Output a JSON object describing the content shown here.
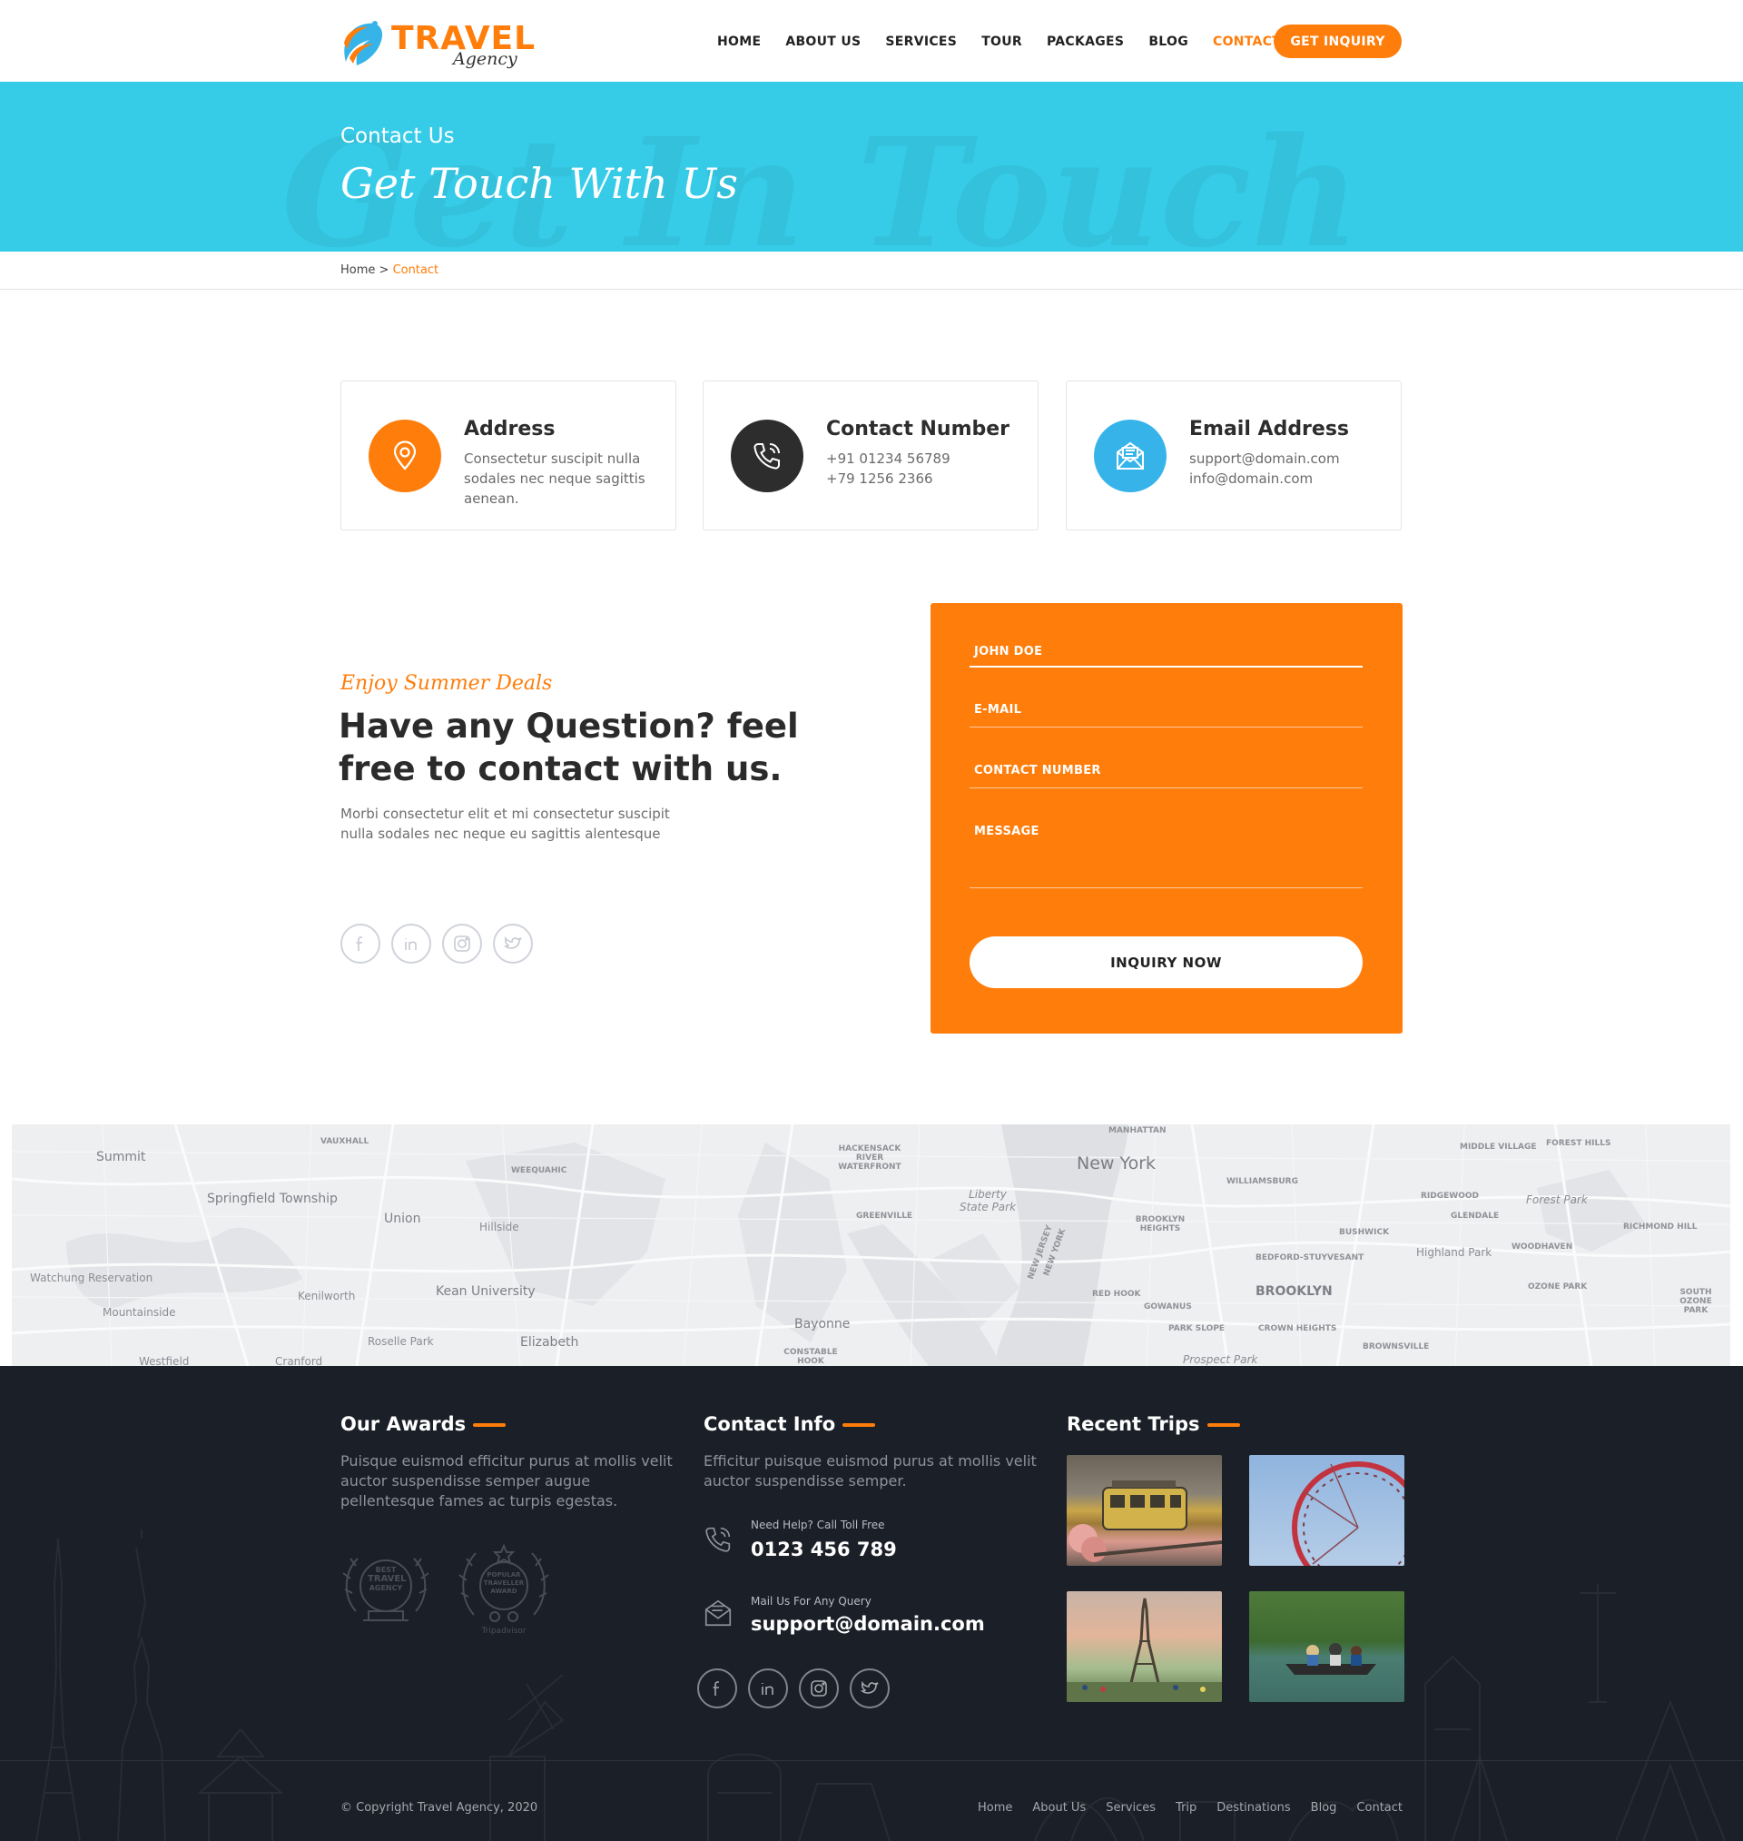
{
  "header": {
    "logo_main": "TRAVEL",
    "logo_sub": "Agency",
    "nav": [
      "HOME",
      "ABOUT US",
      "SERVICES",
      "TOUR",
      "PACKAGES",
      "BLOG",
      "CONTACT"
    ],
    "active_nav": "CONTACT",
    "cta_label": "GET INQUIRY"
  },
  "banner": {
    "subtitle": "Contact Us",
    "title": "Get Touch With Us",
    "watermark": "Get In Touch"
  },
  "breadcrumb": {
    "home": "Home",
    "separator": ">",
    "current": "Contact"
  },
  "cards": [
    {
      "title": "Address",
      "lines": [
        "Consectetur suscipit nulla sodales nec neque sagittis aenean."
      ],
      "icon": "location-pin-icon",
      "color": "#ff7d0a"
    },
    {
      "title": "Contact Number",
      "lines": [
        "+91 01234 56789",
        "+79 1256 2366"
      ],
      "icon": "phone-icon",
      "color": "#2d2d2d"
    },
    {
      "title": "Email Address",
      "lines": [
        "support@domain.com",
        "info@domain.com"
      ],
      "icon": "email-icon",
      "color": "#36b4ea"
    }
  ],
  "question": {
    "label": "Enjoy Summer Deals",
    "title": "Have any Question? feel free to contact with us.",
    "text": "Morbi consectetur elit et mi consectetur suscipit nulla sodales nec neque eu sagittis alentesque"
  },
  "form": {
    "name_placeholder": "JOHN DOE",
    "email_placeholder": "E-MAIL",
    "phone_placeholder": "CONTACT NUMBER",
    "message_placeholder": "MESSAGE",
    "submit_label": "INQUIRY NOW"
  },
  "map": {
    "labels": [
      "Summit",
      "Springfield Township",
      "Union",
      "Hillside",
      "Watchung Reservation",
      "Mountainside",
      "Kenilworth",
      "Kean University",
      "Roselle Park",
      "Elizabeth",
      "Westfield",
      "Cranford",
      "VAUXHALL",
      "WEEQUAHIC",
      "HACKENSACK RIVER WATERFRONT",
      "GREENVILLE",
      "Liberty State Park",
      "Bayonne",
      "CONSTABLE HOOK",
      "MANHATTAN",
      "New York",
      "WILLIAMSBURG",
      "BROOKLYN HEIGHTS",
      "RED HOOK",
      "GOWANUS",
      "PARK SLOPE",
      "BROOKLYN",
      "CROWN HEIGHTS",
      "BROWNSVILLE",
      "Prospect Park",
      "BUSHWICK",
      "BEDFORD-STUYVESANT",
      "RIDGEWOOD",
      "GLENDALE",
      "Highland Park",
      "WOODHAVEN",
      "OZONE PARK",
      "SOUTH OZONE PARK",
      "Forest Park",
      "RICHMOND HILL",
      "MIDDLE VILLAGE",
      "FOREST HILLS",
      "NEW JERSEY",
      "NEW YORK"
    ]
  },
  "footer": {
    "awards": {
      "title": "Our Awards",
      "text": "Puisque euismod efficitur purus at mollis velit auctor suspendisse semper augue pellentesque fames ac turpis egestas.",
      "badge1": [
        "BEST",
        "TRAVEL",
        "AGENCY"
      ],
      "badge2": [
        "POPULAR",
        "TRAVELLER",
        "AWARD",
        "Tripadvisor"
      ]
    },
    "contact": {
      "title": "Contact Info",
      "text": "Efficitur puisque euismod purus at mollis velit auctor suspendisse semper.",
      "phone_label": "Need Help? Call Toll Free",
      "phone": "0123 456 789",
      "mail_label": "Mail Us For Any Query",
      "mail": "support@domain.com"
    },
    "trips": {
      "title": "Recent Trips"
    },
    "copyright": "© Copyright Travel Agency, 2020",
    "nav": [
      "Home",
      "About Us",
      "Services",
      "Trip",
      "Destinations",
      "Blog",
      "Contact"
    ]
  },
  "colors": {
    "accent": "#ff7d0a",
    "banner": "#36cce8",
    "footer": "#1b1f27"
  }
}
